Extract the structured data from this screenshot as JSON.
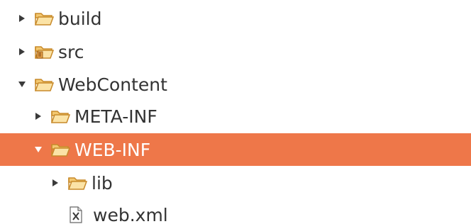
{
  "tree": {
    "items": [
      {
        "label": "build",
        "depth": 0,
        "expanded": false,
        "type": "folder",
        "icon": "folder-icon"
      },
      {
        "label": "src",
        "depth": 0,
        "expanded": false,
        "type": "source-folder",
        "icon": "source-folder-icon"
      },
      {
        "label": "WebContent",
        "depth": 0,
        "expanded": true,
        "type": "folder",
        "icon": "folder-open-icon"
      },
      {
        "label": "META-INF",
        "depth": 1,
        "expanded": false,
        "type": "folder",
        "icon": "folder-icon"
      },
      {
        "label": "WEB-INF",
        "depth": 1,
        "expanded": true,
        "type": "folder",
        "icon": "folder-open-icon",
        "selected": true
      },
      {
        "label": "lib",
        "depth": 2,
        "expanded": false,
        "type": "folder",
        "icon": "folder-icon"
      },
      {
        "label": "web.xml",
        "depth": 2,
        "type": "xml-file",
        "icon": "xml-file-icon"
      }
    ]
  },
  "colors": {
    "selection": "#ee7749",
    "folder_fill": "#f7d68a",
    "folder_stroke": "#c88a2a",
    "text": "#333333",
    "selected_text": "#ffffff"
  }
}
